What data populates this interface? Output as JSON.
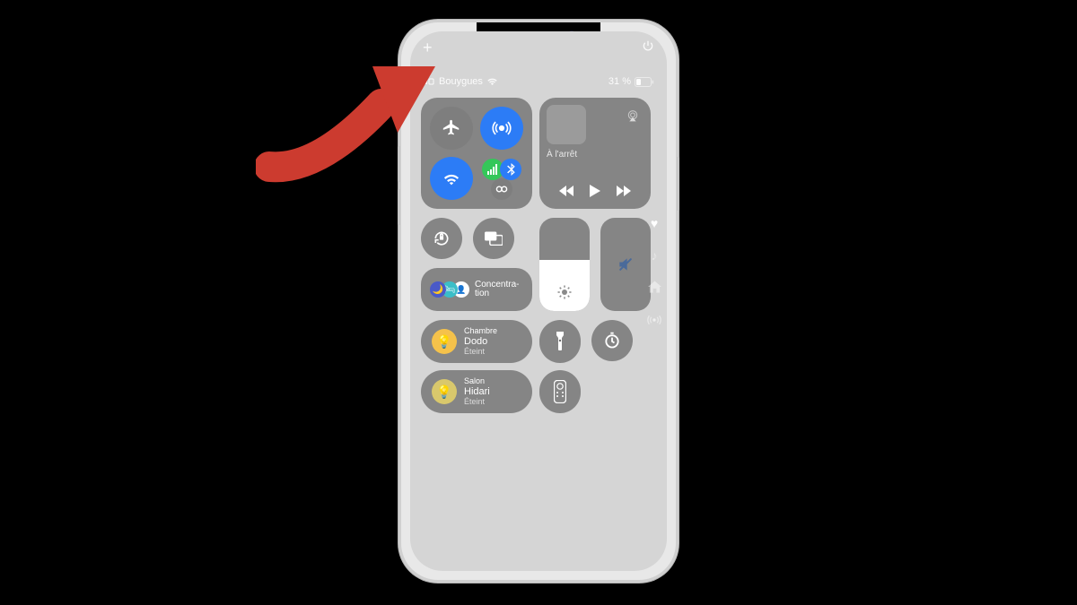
{
  "topbar": {
    "add_icon": "+",
    "power_icon": "power"
  },
  "status": {
    "carrier": "Bouygues",
    "battery_text": "31 %"
  },
  "connectivity": {
    "airplane": "airplane",
    "airdrop": "airdrop",
    "wifi": "wifi",
    "cellular": "signal-bars",
    "bluetooth": "bluetooth",
    "hotspot": "personal-hotspot"
  },
  "media": {
    "status": "À l'arrêt"
  },
  "focus": {
    "label": "Concentra-\ntion"
  },
  "brightness": {
    "percent": 55
  },
  "volume": {
    "muted": true
  },
  "home": [
    {
      "room": "Chambre",
      "name": "Dodo",
      "state": "Éteint",
      "color": "#f5c24b"
    },
    {
      "room": "Salon",
      "name": "Hidari",
      "state": "Éteint",
      "color": "#d9c86c"
    }
  ],
  "side": [
    "heart",
    "music",
    "home",
    "broadcast"
  ],
  "colors": {
    "accent_blue": "#2c7cf6",
    "green": "#34c759"
  }
}
